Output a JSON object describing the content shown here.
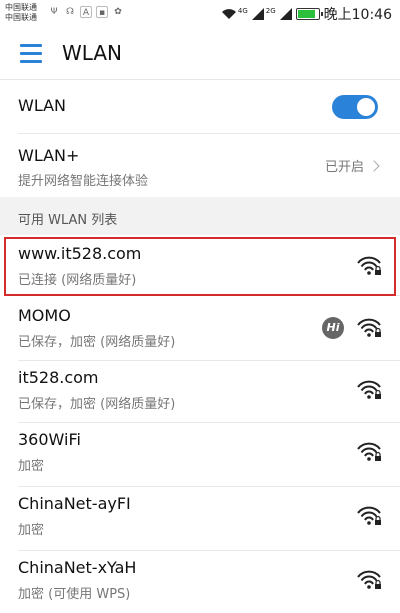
{
  "status_bar": {
    "carrier1": "中国联通",
    "carrier2": "中国联通",
    "signal1_label": "4G",
    "signal2_label": "2G",
    "time": "晚上10:46",
    "battery_color": "#2bbf3b"
  },
  "appbar": {
    "title": "WLAN"
  },
  "wlan_row": {
    "label": "WLAN",
    "toggle_on": true
  },
  "wlan_plus": {
    "label": "WLAN+",
    "subtitle": "提升网络智能连接体验",
    "status": "已开启"
  },
  "section": {
    "header": "可用 WLAN 列表"
  },
  "networks": [
    {
      "name": "www.it528.com",
      "status": "已连接 (网络质量好)",
      "icon": "wifi-lock-icon"
    },
    {
      "name": "MOMO",
      "status": "已保存，加密 (网络质量好)",
      "icon": "wifi-lock-icon",
      "badge": "Hi"
    },
    {
      "name": "it528.com",
      "status": "已保存，加密 (网络质量好)",
      "icon": "wifi-lock-icon"
    },
    {
      "name": "360WiFi",
      "status": "加密",
      "icon": "wifi-lock-icon"
    },
    {
      "name": "ChinaNet-ayFI",
      "status": "加密",
      "icon": "wifi-lock-icon"
    },
    {
      "name": "ChinaNet-xYaH",
      "status": "加密 (可使用 WPS)",
      "icon": "wifi-lock-icon"
    }
  ],
  "colors": {
    "accent": "#2a83d8",
    "highlight": "#d62b2b"
  }
}
